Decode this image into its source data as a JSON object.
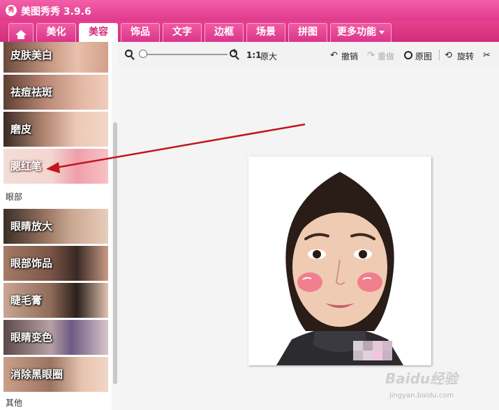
{
  "window": {
    "title": "美图秀秀 3.9.6",
    "logo_text": "秀"
  },
  "tabs": [
    {
      "label": "",
      "icon": "home-icon"
    },
    {
      "label": "美化"
    },
    {
      "label": "美容"
    },
    {
      "label": "饰品"
    },
    {
      "label": "文字"
    },
    {
      "label": "边框"
    },
    {
      "label": "场景"
    },
    {
      "label": "拼图"
    },
    {
      "label": "更多功能"
    }
  ],
  "sidebar": {
    "items_top": [
      "皮肤美白",
      "祛痘祛斑",
      "磨皮",
      "腮红笔"
    ],
    "section_eyes": "眼部",
    "items_eyes": [
      "眼睛放大",
      "眼部饰品",
      "睫毛膏",
      "眼睛变色",
      "消除黑眼圈"
    ],
    "section_other": "其他"
  },
  "toolbar": {
    "ratio": "1:1",
    "original_size": "原大",
    "undo": "撤销",
    "redo": "重做",
    "original": "原图",
    "rotate": "旋转"
  },
  "watermark": {
    "brand": "Baidu经验",
    "url": "jingyan.baidu.com"
  },
  "colors": {
    "accent": "#e03a8e",
    "arrow": "#c0161c",
    "blush": "#f06a85"
  }
}
